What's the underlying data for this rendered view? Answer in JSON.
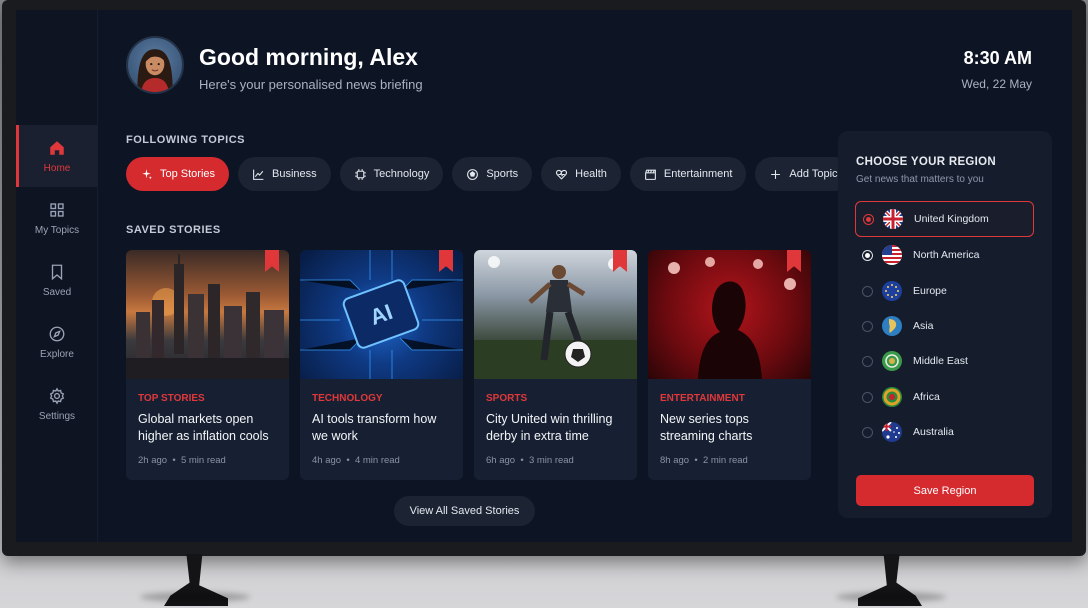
{
  "header": {
    "greeting": "Good morning, Alex",
    "subtitle": "Here's your personalised news briefing",
    "time": "8:30 AM",
    "date": "Wed, 22 May"
  },
  "sidebar": {
    "items": [
      {
        "label": "Home",
        "icon": "home-icon",
        "active": true
      },
      {
        "label": "My Topics",
        "icon": "grid-icon",
        "active": false
      },
      {
        "label": "Saved",
        "icon": "bookmark-icon",
        "active": false
      },
      {
        "label": "Explore",
        "icon": "compass-icon",
        "active": false
      },
      {
        "label": "Settings",
        "icon": "gear-icon",
        "active": false
      }
    ]
  },
  "topics": {
    "title": "FOLLOWING TOPICS",
    "items": [
      {
        "label": "Top Stories",
        "icon": "sparkle-icon",
        "active": true
      },
      {
        "label": "Business",
        "icon": "chart-icon"
      },
      {
        "label": "Technology",
        "icon": "chip-icon"
      },
      {
        "label": "Sports",
        "icon": "ball-icon"
      },
      {
        "label": "Health",
        "icon": "heart-icon"
      },
      {
        "label": "Entertainment",
        "icon": "clapper-icon"
      },
      {
        "label": "Add Topic",
        "icon": "plus-icon"
      }
    ]
  },
  "saved": {
    "title": "SAVED STORIES",
    "view_all": "View All Saved Stories",
    "stories": [
      {
        "category": "TOP STORIES",
        "title": "Global markets open higher as inflation cools",
        "age": "2h ago",
        "read": "5 min read",
        "image": "city-skyline"
      },
      {
        "category": "TECHNOLOGY",
        "title": "AI tools transform how we work",
        "age": "4h ago",
        "read": "4 min read",
        "image": "ai-chip"
      },
      {
        "category": "SPORTS",
        "title": "City United win thrilling derby in extra time",
        "age": "6h ago",
        "read": "3 min read",
        "image": "football-player"
      },
      {
        "category": "ENTERTAINMENT",
        "title": "New series tops streaming charts",
        "age": "8h ago",
        "read": "2 min read",
        "image": "stage-silhouette"
      }
    ]
  },
  "region": {
    "title": "CHOOSE YOUR REGION",
    "subtitle": "Get news that matters to you",
    "save_label": "Save Region",
    "options": [
      {
        "label": "United Kingdom",
        "flag": "uk-flag-icon",
        "state": "selected"
      },
      {
        "label": "North America",
        "flag": "us-flag-icon",
        "state": "focused"
      },
      {
        "label": "Europe",
        "flag": "eu-flag-icon",
        "state": "none"
      },
      {
        "label": "Asia",
        "flag": "asia-globe-icon",
        "state": "none"
      },
      {
        "label": "Middle East",
        "flag": "middle-east-globe-icon",
        "state": "none"
      },
      {
        "label": "Africa",
        "flag": "africa-globe-icon",
        "state": "none"
      },
      {
        "label": "Australia",
        "flag": "australia-flag-icon",
        "state": "none"
      }
    ]
  },
  "colors": {
    "accent": "#e0383a",
    "background": "#0d1424",
    "panel": "#151d2d"
  }
}
